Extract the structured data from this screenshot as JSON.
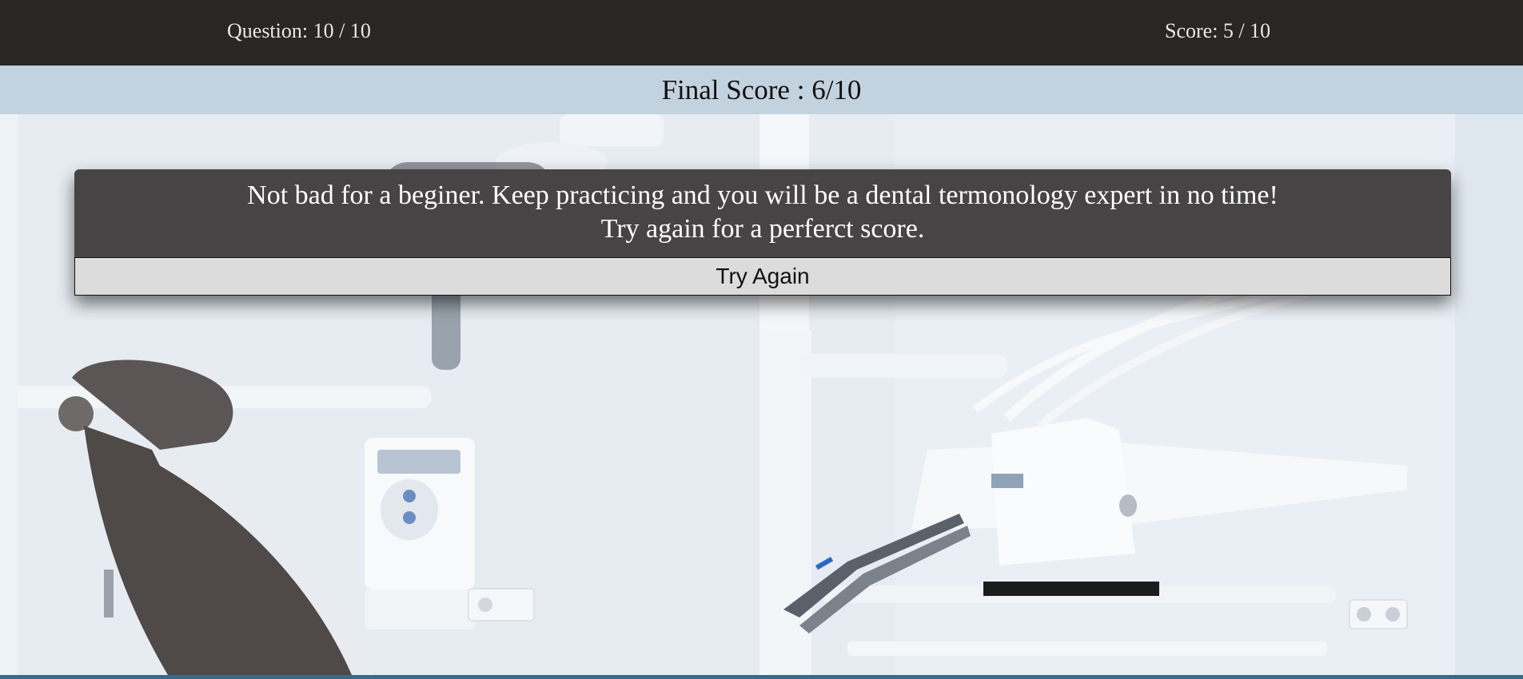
{
  "header": {
    "question_progress": "Question: 10 / 10",
    "score": "Score: 5 / 10"
  },
  "final_score": "Final Score : 6/10",
  "result": {
    "message_line1": "Not bad for a beginer. Keep practicing and you will be a dental termonology expert in no time!",
    "message_line2": "Try again for a perferct score.",
    "try_again_label": "Try Again"
  },
  "colors": {
    "topbar": "#2b2626",
    "band": "#c3d2df",
    "modal": "#464444",
    "button": "#dcdcdc"
  }
}
